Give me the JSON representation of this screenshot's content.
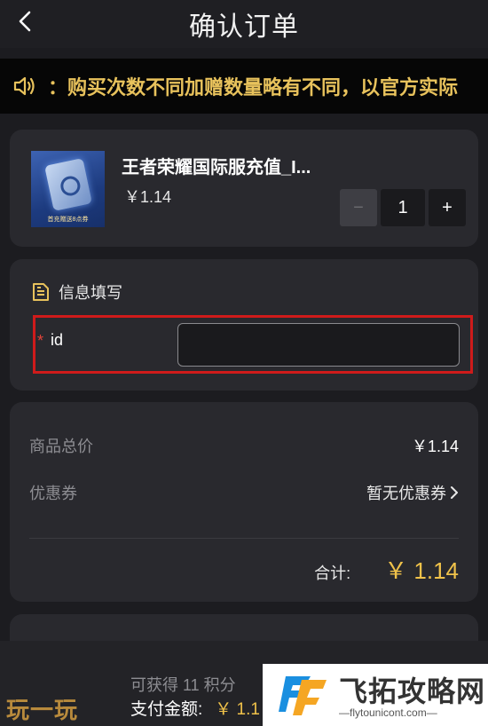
{
  "header": {
    "title": "确认订单"
  },
  "notice": {
    "text": "：购买次数不同加赠数量略有不同，以官方实际"
  },
  "product": {
    "name": "王者荣耀国际服充值_I...",
    "price": "￥1.14",
    "thumb_caption": "首充赠送8点券",
    "quantity": "1",
    "minus_label": "−",
    "plus_label": "+"
  },
  "info": {
    "section_title": "信息填写",
    "required_mark": "*",
    "field_label": "id",
    "field_value": "",
    "field_placeholder": ""
  },
  "summary": {
    "goods_total_label": "商品总价",
    "goods_total_value": "￥1.14",
    "coupon_label": "优惠券",
    "coupon_value": "暂无优惠券",
    "total_label": "合计:",
    "total_value": "￥ 1.14"
  },
  "footer": {
    "points_text": "可获得 11 积分",
    "pay_label": "支付金额:",
    "pay_amount": "￥ 1.1"
  },
  "watermarks": {
    "left": "玩一玩",
    "right_name": "飞拓攻略网",
    "right_url": "—flytounicont.com—"
  },
  "colors": {
    "accent": "#f0c24a",
    "required": "#cf1b1b",
    "background": "#1c1c20",
    "card": "#29292e"
  }
}
